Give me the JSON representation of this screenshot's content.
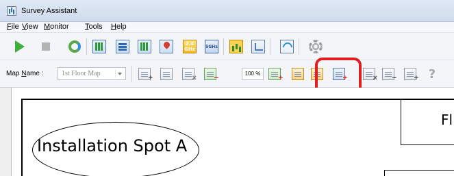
{
  "window": {
    "title": "Survey Assistant"
  },
  "menu": {
    "items": [
      {
        "underline": "F",
        "rest": "ile"
      },
      {
        "underline": "V",
        "rest": "iew"
      },
      {
        "underline": "M",
        "rest": "onitor"
      },
      {
        "underline": "T",
        "rest": "ools"
      },
      {
        "underline": "H",
        "rest": "elp"
      }
    ]
  },
  "toolbar1": {
    "band24_line1": "2.4",
    "band24_line2": "GHz",
    "band5_label": "5GHz"
  },
  "toolbar2": {
    "mapname_underline": "N",
    "mapname_prefix": "Map ",
    "mapname_suffix": "ame :",
    "map_selected": "1st Floor Map",
    "zoom": "100 %"
  },
  "canvas": {
    "spot_label": "Installation Spot A",
    "floor_label": "Fl"
  },
  "colors": {
    "highlight": "#e02020",
    "play": "#3fae3f"
  }
}
